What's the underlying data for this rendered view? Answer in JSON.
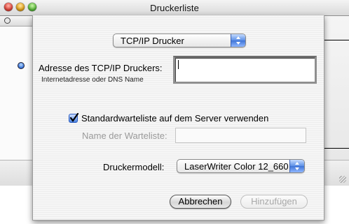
{
  "window": {
    "title": "Druckerliste"
  },
  "sheet": {
    "protocol_popup": {
      "selected": "TCP/IP Drucker"
    },
    "address": {
      "label": "Adresse des TCP/IP Druckers:",
      "hint": "Internetadresse oder DNS Name",
      "value": ""
    },
    "queue_checkbox": {
      "label": "Standardwarteliste auf dem Server verwenden",
      "checked": true
    },
    "queue_name": {
      "label": "Name der Warteliste:",
      "value": "",
      "enabled": false
    },
    "printer_model": {
      "label": "Druckermodell:",
      "selected": "LaserWriter Color 12_660"
    },
    "buttons": {
      "cancel": "Abbrechen",
      "add": "Hinzufügen"
    }
  },
  "colors": {
    "popup_arrow_blue": "#3f74d6",
    "disabled_text": "#9a9a9a"
  }
}
